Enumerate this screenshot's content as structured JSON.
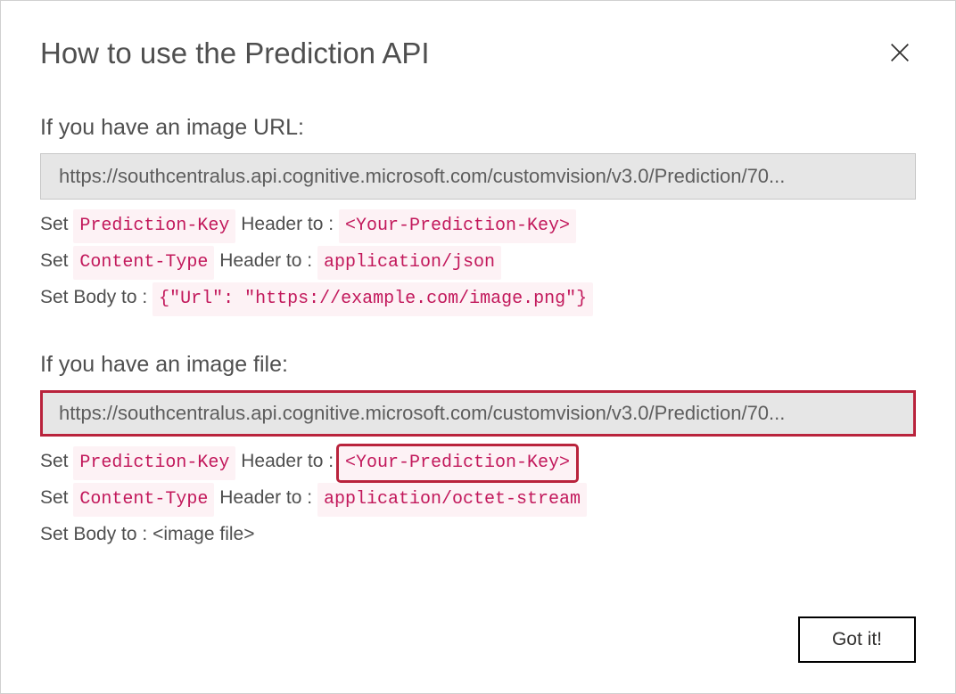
{
  "dialogTitle": "How to use the Prediction API",
  "imageUrlSection": {
    "title": "If you have an image URL:",
    "endpoint": "https://southcentralus.api.cognitive.microsoft.com/customvision/v3.0/Prediction/70...",
    "line1_prefix": "Set ",
    "line1_chip1": "Prediction-Key",
    "line1_mid": " Header to : ",
    "line1_chip2": "<Your-Prediction-Key>",
    "line2_prefix": "Set ",
    "line2_chip1": "Content-Type",
    "line2_mid": " Header to : ",
    "line2_chip2": "application/json",
    "line3_prefix": "Set Body to : ",
    "line3_chip": "{\"Url\": \"https://example.com/image.png\"}"
  },
  "imageFileSection": {
    "title": "If you have an image file:",
    "endpoint": "https://southcentralus.api.cognitive.microsoft.com/customvision/v3.0/Prediction/70...",
    "line1_prefix": "Set ",
    "line1_chip1": "Prediction-Key",
    "line1_mid": " Header to : ",
    "line1_chip2": "<Your-Prediction-Key>",
    "line2_prefix": "Set ",
    "line2_chip1": "Content-Type",
    "line2_mid": " Header to : ",
    "line2_chip2": "application/octet-stream",
    "line3": "Set Body to : <image file>"
  },
  "gotItLabel": "Got it!"
}
